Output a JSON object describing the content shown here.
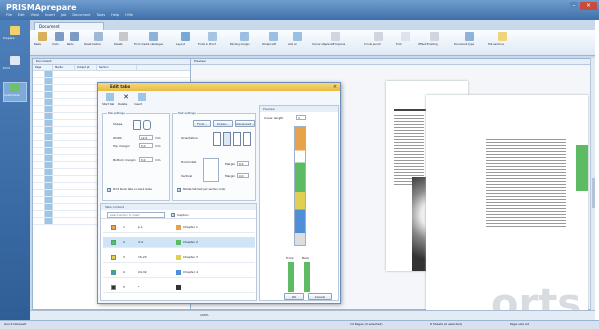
{
  "app": {
    "title": "PRISMAprepare"
  },
  "menu": [
    "File",
    "Edit",
    "View",
    "Insert",
    "Job",
    "Document",
    "Tools",
    "Help",
    "Hilfe"
  ],
  "nav": [
    {
      "label": "Prepare",
      "icon": "prepare-icon"
    },
    {
      "label": "Print",
      "icon": "print-icon"
    },
    {
      "label": "Customize",
      "icon": "customize-icon"
    }
  ],
  "document_tab": "Document",
  "ribbon": [
    "Paste",
    "Undo",
    "Redo",
    "Sheet before",
    "Delete",
    "From media catalogue",
    "Layout",
    "Fonts in Proof",
    "Binding margin",
    "Simple left",
    "Add on",
    "Corner staple left top/one",
    "2 hole punch",
    "Fold",
    "Offset finishing",
    "Document type",
    "Tab sections"
  ],
  "grid": {
    "pane_title": "Document",
    "headers": [
      "Page",
      "Media",
      "Output pt",
      "Section"
    ],
    "rows": 22
  },
  "preview_pane_title": "Preview",
  "watermark": "orts",
  "dialog": {
    "title": "Edit tabs",
    "close": "×",
    "tools": [
      "Start tab",
      "Delete",
      "Insert"
    ],
    "tab_settings": {
      "legend": "Tab settings",
      "shape_label": "Shape",
      "width_label": "Width",
      "width_value": "12.0",
      "top_margin_label": "Top margin",
      "top_margin_value": "5.0",
      "bottom_margin_label": "Bottom margin",
      "bottom_margin_value": "5.0",
      "unit": "mm",
      "print_label": "Print blank tabs on back sides"
    },
    "text_settings": {
      "legend": "Text settings",
      "font_btn": "Font...",
      "colour_btn": "Colour...",
      "advanced_btn": "Advanced...",
      "orientation_label": "Orientation",
      "horizontal_label": "Horizontal",
      "vertical_label": "Vertical",
      "margin_label": "Margin",
      "margin1": "0.0",
      "margin2": "0.0",
      "unit": "mm",
      "rotate_label": "Rotate tab text per section order"
    },
    "section_list": {
      "title": "Tabs content",
      "search_placeholder": "select section to insert",
      "caption_label": "Caption",
      "rows": [
        {
          "no": "1",
          "pages": "p.1",
          "chapter": "Chapter 1",
          "color": "#e8a24a"
        },
        {
          "no": "2",
          "pages": "3-4",
          "chapter": "Chapter 2",
          "color": "#5dbb63"
        },
        {
          "no": "3",
          "pages": "15-23",
          "chapter": "Chapter 3",
          "color": "#e0d04f"
        },
        {
          "no": "4",
          "pages": "24-32",
          "chapter": "Chapter 4",
          "color": "#4f8fd8"
        },
        {
          "no": "5",
          "pages": "*",
          "chapter": "",
          "color": "#333333"
        }
      ]
    },
    "preview": {
      "title": "Preview",
      "cover_length_label": "Cover length",
      "cover_length_value": "3",
      "front_label": "Front",
      "back_label": "Back"
    },
    "ok_btn": "OK",
    "cancel_btn": "Cancel"
  },
  "statusbar": {
    "left": "Quick tabs/self",
    "zoom": "100%",
    "sheets": "14 Pages (0 selected)",
    "selected": "8 Sheets (0 selected)",
    "pagesize": "Page size A4"
  }
}
